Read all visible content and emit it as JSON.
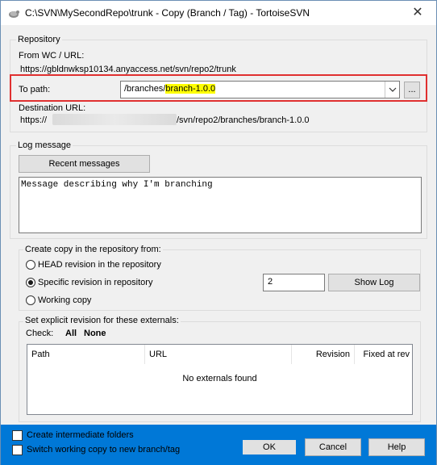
{
  "window": {
    "title": "C:\\SVN\\MySecondRepo\\trunk - Copy (Branch / Tag) - TortoiseSVN",
    "close_glyph": "✕"
  },
  "repository": {
    "group_label": "Repository",
    "from_label": "From WC / URL:",
    "from_url": "https://gbldnwksp10134.anyaccess.net/svn/repo2/trunk",
    "to_path_label": "To path:",
    "to_path_prefix": "/branches/",
    "to_path_highlight": "branch-1.0.0",
    "browse_label": "...",
    "dest_label": "Destination URL:",
    "dest_prefix": "https://",
    "dest_suffix": "/svn/repo2/branches/branch-1.0.0"
  },
  "log": {
    "group_label": "Log message",
    "recent_button": "Recent messages",
    "message": "Message describing why I'm branching"
  },
  "copy_from": {
    "group_label": "Create copy in the repository from:",
    "options": [
      {
        "label": "HEAD revision in the repository",
        "selected": false
      },
      {
        "label": "Specific revision in repository",
        "selected": true
      },
      {
        "label": "Working copy",
        "selected": false
      }
    ],
    "revision_value": "2",
    "show_log_button": "Show Log"
  },
  "externals": {
    "group_label": "Set explicit revision for these externals:",
    "check_label": "Check:",
    "all_link": "All",
    "none_link": "None",
    "columns": [
      "Path",
      "URL",
      "Revision",
      "Fixed at rev"
    ],
    "empty_text": "No externals found"
  },
  "footer": {
    "create_folders_label": "Create intermediate folders",
    "switch_label": "Switch working copy to new branch/tag",
    "ok_button": "OK",
    "cancel_button": "Cancel",
    "help_button": "Help"
  },
  "colors": {
    "footer_bg": "#0078d7",
    "highlight": "#ffff00",
    "red_outline": "#e03030"
  }
}
